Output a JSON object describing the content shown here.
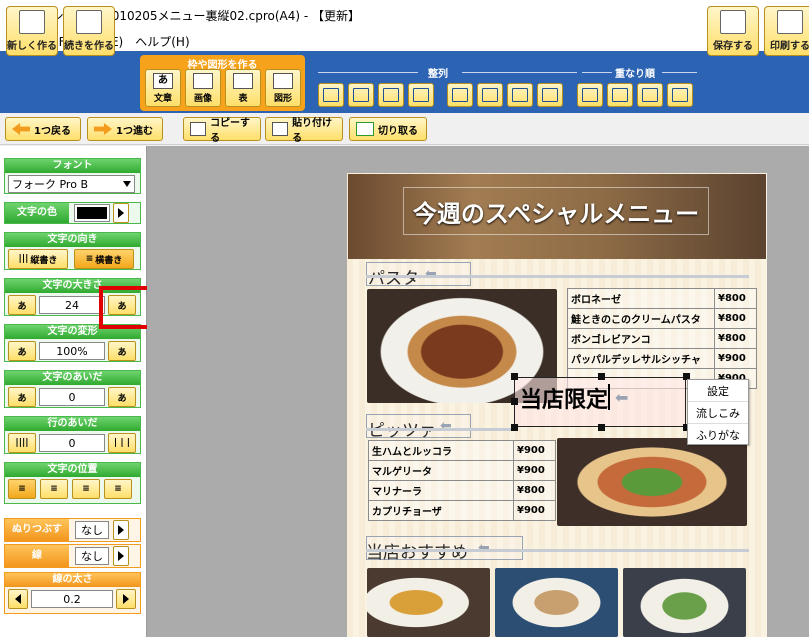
{
  "title": "チラシのプロ - 010205メニュー裏縦02.cpro(A4) - 【更新】",
  "menu": [
    "ファイル(F)",
    "編集(E)",
    "ヘルプ(H)"
  ],
  "toolbar": {
    "new": "新しく作る",
    "continue": "続きを作る",
    "frame_group": "枠や図形を作る",
    "frames": [
      "文章",
      "画像",
      "表",
      "図形"
    ],
    "align_label": "整列",
    "order_label": "重なり順",
    "save": "保存する",
    "print": "印刷する"
  },
  "subbar": {
    "undo": "1つ戻る",
    "redo": "1つ進む",
    "copy": "コピーする",
    "paste": "貼り付ける",
    "cut": "切り取る"
  },
  "sidebar": {
    "font_ttl": "フォント",
    "font_val": "フォーク Pro B",
    "color_ttl": "文字の色",
    "dir_ttl": "文字の向き",
    "dir_v": "縦書き",
    "dir_h": "横書き",
    "size_ttl": "文字の大きさ",
    "size_val": "24",
    "transform_ttl": "文字の変形",
    "transform_val": "100%",
    "spacing_ttl": "文字のあいだ",
    "spacing_val": "0",
    "line_ttl": "行のあいだ",
    "line_val": "0",
    "pos_ttl": "文字の位置",
    "fill_ttl": "ぬりつぶす",
    "fill_val": "なし",
    "stroke_ttl": "線",
    "stroke_val": "なし",
    "width_ttl": "線の太さ",
    "width_val": "0.2",
    "glyph_small": "あ",
    "glyph_pair": "あ",
    "glyph_v": "あ",
    "glyph_h": "あ"
  },
  "canvas": {
    "banner": "今週のスペシャルメニュー",
    "pasta": "パスタ",
    "pizza": "ピッツァ",
    "recommend": "当店おすすめ",
    "selected_text": "当店限定",
    "pasta_items": [
      [
        "ボロネーゼ",
        "¥800"
      ],
      [
        "鮭ときのこのクリームパスタ",
        "¥800"
      ],
      [
        "ボンゴレビアンコ",
        "¥800"
      ],
      [
        "パッパルデッレサルシッチャ",
        "¥900"
      ],
      [
        "",
        "¥900"
      ]
    ],
    "pizza_items": [
      [
        "生ハムとルッコラ",
        "¥900"
      ],
      [
        "マルゲリータ",
        "¥900"
      ],
      [
        "マリナーラ",
        "¥800"
      ],
      [
        "カプリチョーザ",
        "¥900"
      ]
    ]
  },
  "context": [
    "設定",
    "流しこみ",
    "ふりがな"
  ],
  "colors": {
    "accent": "#2d63b3",
    "highlight": "#e00000",
    "button": "#ffdf6a"
  }
}
